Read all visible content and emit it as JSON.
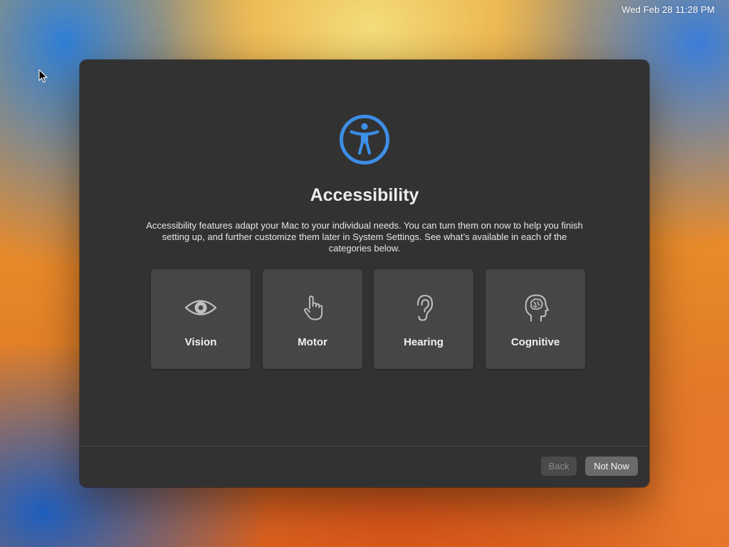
{
  "menubar": {
    "clock": "Wed Feb 28  11:28 PM"
  },
  "dialog": {
    "icon": "accessibility-icon",
    "title": "Accessibility",
    "description": "Accessibility features adapt your Mac to your individual needs. You can turn them on now to help you finish setting up, and further customize them later in System Settings. See what’s available in each of the categories below.",
    "categories": [
      {
        "label": "Vision",
        "icon": "eye-icon"
      },
      {
        "label": "Motor",
        "icon": "hand-pointer-icon"
      },
      {
        "label": "Hearing",
        "icon": "ear-icon"
      },
      {
        "label": "Cognitive",
        "icon": "brain-head-icon"
      }
    ],
    "buttons": {
      "back": "Back",
      "not_now": "Not Now"
    }
  },
  "colors": {
    "accent": "#3d8ee6",
    "window_background": "#323232",
    "card_background": "#464646"
  }
}
